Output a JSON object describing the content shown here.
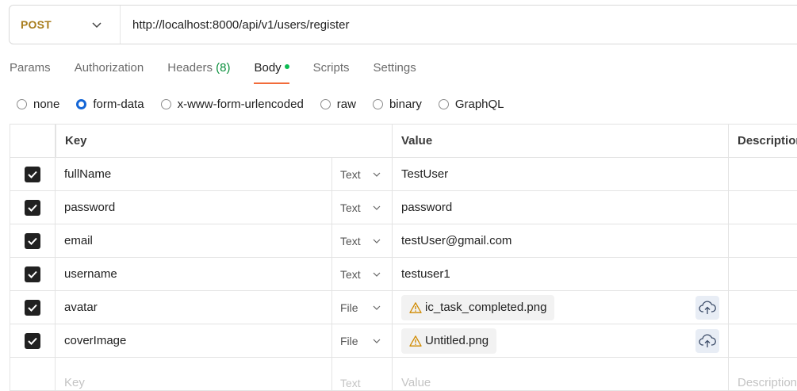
{
  "request": {
    "method": "POST",
    "url": "http://localhost:8000/api/v1/users/register"
  },
  "tabs": [
    {
      "label": "Params"
    },
    {
      "label": "Authorization"
    },
    {
      "label": "Headers",
      "count": "(8)"
    },
    {
      "label": "Body",
      "active": true
    },
    {
      "label": "Scripts"
    },
    {
      "label": "Settings"
    }
  ],
  "body_types": [
    {
      "label": "none"
    },
    {
      "label": "form-data",
      "selected": true
    },
    {
      "label": "x-www-form-urlencoded"
    },
    {
      "label": "raw"
    },
    {
      "label": "binary"
    },
    {
      "label": "GraphQL"
    }
  ],
  "table": {
    "headers": {
      "key": "Key",
      "value": "Value",
      "description": "Description"
    },
    "rows": [
      {
        "key": "fullName",
        "type": "Text",
        "value": "TestUser",
        "checked": true
      },
      {
        "key": "password",
        "type": "Text",
        "value": "password",
        "checked": true
      },
      {
        "key": "email",
        "type": "Text",
        "value": "testUser@gmail.com",
        "checked": true
      },
      {
        "key": "username",
        "type": "Text",
        "value": "testuser1",
        "checked": true
      },
      {
        "key": "avatar",
        "type": "File",
        "value": "ic_task_completed.png",
        "checked": true
      },
      {
        "key": "coverImage",
        "type": "File",
        "value": "Untitled.png",
        "checked": true
      }
    ],
    "placeholder": {
      "key": "Key",
      "type": "Text",
      "value": "Value",
      "description": "Description"
    }
  },
  "colors": {
    "method": "#a87d1d",
    "active_tab_underline": "#f26b3a",
    "body_dot": "#0cbb52",
    "radio_selected": "#1466d6",
    "headers_count": "#0a8f3c",
    "warning": "#d08a00"
  },
  "icons": {
    "method_dropdown": "chevron-down-icon",
    "type_dropdown": "chevron-down-icon",
    "checkbox": "checkmark-icon",
    "file_warning": "warning-triangle-icon",
    "upload": "cloud-upload-icon"
  }
}
